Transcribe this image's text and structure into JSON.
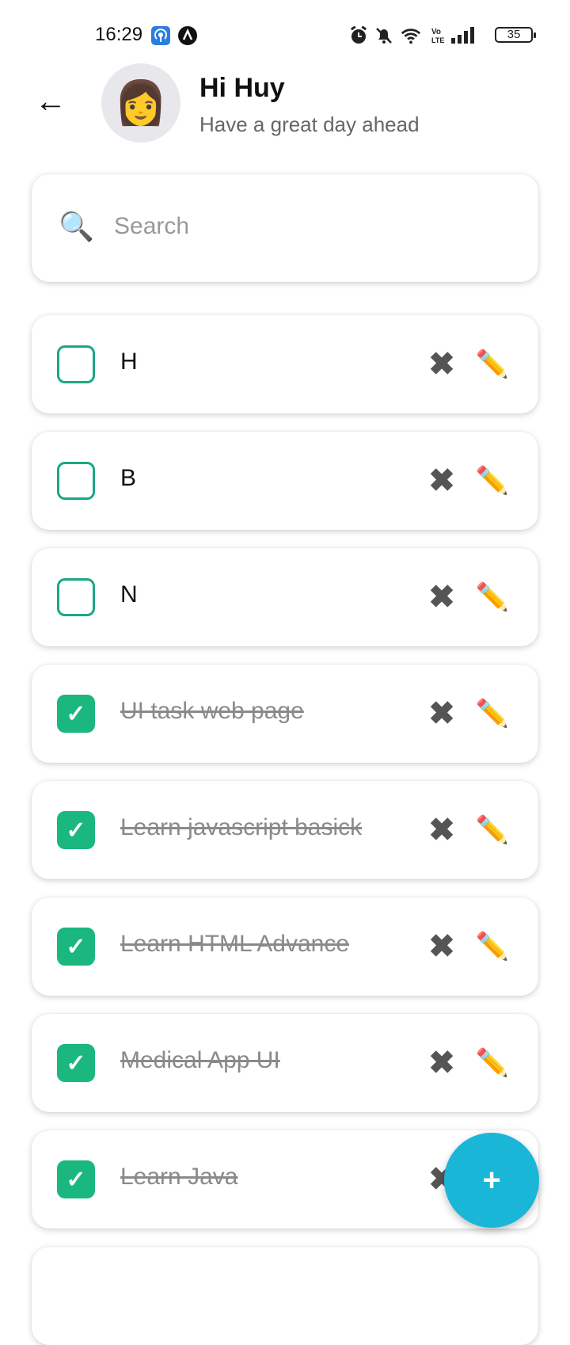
{
  "status_bar": {
    "time": "16:29",
    "battery": "35",
    "icons": [
      "hotspot-icon",
      "app-badge-icon",
      "alarm-icon",
      "bell-off-icon",
      "wifi-icon",
      "volte-icon",
      "signal-icon",
      "battery-icon"
    ]
  },
  "header": {
    "back_icon": "←",
    "avatar_emoji": "👩",
    "title": "Hi Huy",
    "subtitle": "Have a great day ahead"
  },
  "search": {
    "icon": "🔍",
    "placeholder": "Search",
    "value": ""
  },
  "tasks": [
    {
      "label": "H",
      "done": false
    },
    {
      "label": "B",
      "done": false
    },
    {
      "label": "N",
      "done": false
    },
    {
      "label": "UI task web page",
      "done": true
    },
    {
      "label": "Learn javascript basick",
      "done": true
    },
    {
      "label": "Learn HTML Advance",
      "done": true
    },
    {
      "label": "Medical App UI",
      "done": true
    },
    {
      "label": "Learn Java",
      "done": true
    }
  ],
  "task_icons": {
    "check": "✓",
    "delete": "✖",
    "edit": "✏️"
  },
  "fab": {
    "label": "+"
  },
  "colors": {
    "accent_green": "#1ab77e",
    "fab_blue": "#1ab6d8"
  }
}
